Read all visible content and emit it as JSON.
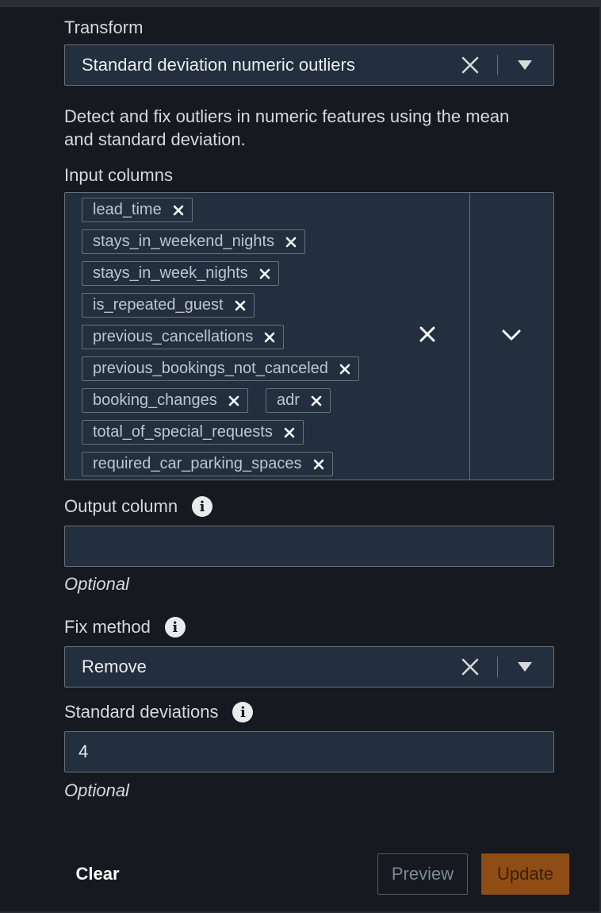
{
  "transform": {
    "label": "Transform",
    "value": "Standard deviation numeric outliers",
    "clear_icon": "close-icon",
    "caret_icon": "caret-down-icon"
  },
  "description": "Detect and fix outliers in numeric features using the mean and standard deviation.",
  "input_columns": {
    "label": "Input columns",
    "tokens": [
      "lead_time",
      "stays_in_weekend_nights",
      "stays_in_week_nights",
      "is_repeated_guest",
      "previous_cancellations",
      "previous_bookings_not_canceled",
      "booking_changes",
      "adr",
      "total_of_special_requests",
      "required_car_parking_spaces"
    ]
  },
  "output_column": {
    "label": "Output column",
    "value": "",
    "hint": "Optional"
  },
  "fix_method": {
    "label": "Fix method",
    "value": "Remove"
  },
  "std_devs": {
    "label": "Standard deviations",
    "value": "4",
    "hint": "Optional"
  },
  "buttons": {
    "clear": "Clear",
    "preview": "Preview",
    "update": "Update"
  },
  "colors": {
    "background": "#16191f",
    "field_bg": "#232f3e",
    "border": "#687078",
    "update_bg": "#8f4d16"
  }
}
